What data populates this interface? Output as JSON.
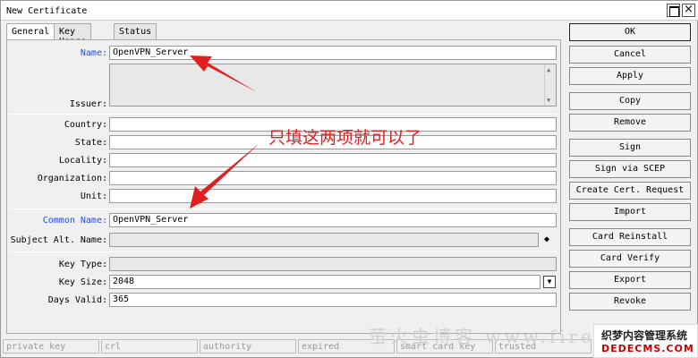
{
  "window": {
    "title": "New Certificate",
    "close_glyph": "×"
  },
  "tabs": [
    {
      "label": "General",
      "active": true
    },
    {
      "label": "Key Usage",
      "active": false
    },
    {
      "label": "Status",
      "active": false
    }
  ],
  "form": {
    "name_label": "Name:",
    "name_value": "OpenVPN_Server",
    "issuer_label": "Issuer:",
    "country_label": "Country:",
    "state_label": "State:",
    "locality_label": "Locality:",
    "organization_label": "Organization:",
    "unit_label": "Unit:",
    "common_name_label": "Common Name:",
    "common_name_value": "OpenVPN_Server",
    "subject_alt_label": "Subject Alt. Name:",
    "key_type_label": "Key Type:",
    "key_size_label": "Key Size:",
    "key_size_value": "2048",
    "days_valid_label": "Days Valid:",
    "days_valid_value": "365"
  },
  "buttons": {
    "ok": "OK",
    "cancel": "Cancel",
    "apply": "Apply",
    "copy": "Copy",
    "remove": "Remove",
    "sign": "Sign",
    "sign_scep": "Sign via SCEP",
    "create_request": "Create Cert. Request",
    "import": "Import",
    "card_reinstall": "Card Reinstall",
    "card_verify": "Card Verify",
    "export": "Export",
    "revoke": "Revoke"
  },
  "status": [
    "private key",
    "crl",
    "authority",
    "expired",
    "smart card key",
    "trusted"
  ],
  "annotation": {
    "text": "只填这两项就可以了",
    "color": "#e02020"
  },
  "watermark": {
    "text": "萤火虫博客 www.firefl",
    "logo_line1": "织梦内容管理系统",
    "logo_line2": "DEDECMS.COM"
  }
}
